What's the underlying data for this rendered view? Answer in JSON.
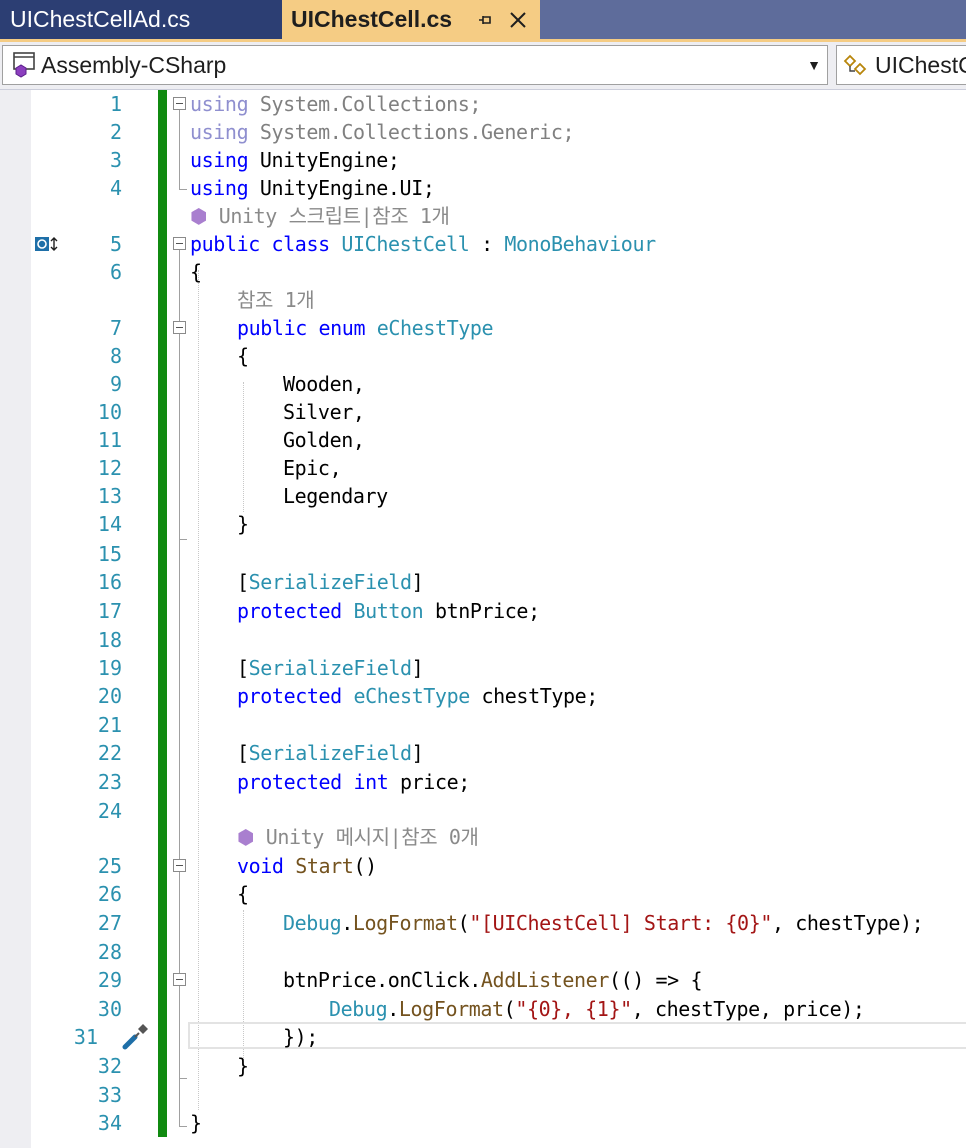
{
  "tabs": [
    {
      "label": "UIChestCellAd.cs",
      "active": false
    },
    {
      "label": "UIChestCell.cs",
      "active": true
    }
  ],
  "tab_icons": {
    "pin": "pin-icon",
    "close": "close-icon"
  },
  "nav": {
    "project": "Assembly-CSharp",
    "class": "UIChestC"
  },
  "lens": {
    "class_refs": "Unity 스크립트|참조 1개",
    "enum_refs": "참조 1개",
    "start_refs": "Unity 메시지|참조 0개"
  },
  "line_numbers": [
    "1",
    "2",
    "3",
    "4",
    "5",
    "6",
    "7",
    "8",
    "9",
    "10",
    "11",
    "12",
    "13",
    "14",
    "15",
    "16",
    "17",
    "18",
    "19",
    "20",
    "21",
    "22",
    "23",
    "24",
    "25",
    "26",
    "27",
    "28",
    "29",
    "30",
    "31",
    "32",
    "33",
    "34"
  ],
  "code": {
    "l1_kw": "using",
    "l1_rest": " System.Collections;",
    "l2_kw": "using",
    "l2_rest": " System.Collections.Generic;",
    "l3_kw": "using",
    "l3_rest": " UnityEngine;",
    "l4_kw": "using",
    "l4_rest": " UnityEngine.UI;",
    "l5_kw1": "public",
    "l5_kw2": "class",
    "l5_name": "UIChestCell",
    "l5_colon": " : ",
    "l5_base": "MonoBehaviour",
    "l6": "{",
    "l7_kw1": "public",
    "l7_kw2": "enum",
    "l7_name": "eChestType",
    "l8": "{",
    "l9": "Wooden,",
    "l10": "Silver,",
    "l11": "Golden,",
    "l12": "Epic,",
    "l13": "Legendary",
    "l14": "}",
    "l16_open": "[",
    "l16_attr": "SerializeField",
    "l16_close": "]",
    "l17_kw": "protected",
    "l17_type": "Button",
    "l17_rest": " btnPrice;",
    "l19_open": "[",
    "l19_attr": "SerializeField",
    "l19_close": "]",
    "l20_kw": "protected",
    "l20_type": "eChestType",
    "l20_rest": " chestType;",
    "l22_open": "[",
    "l22_attr": "SerializeField",
    "l22_close": "]",
    "l23_kw1": "protected",
    "l23_kw2": "int",
    "l23_rest": " price;",
    "l25_kw": "void",
    "l25_name": "Start",
    "l25_rest": "()",
    "l26": "{",
    "l27_type": "Debug",
    "l27_dot": ".",
    "l27_method": "LogFormat",
    "l27_open": "(",
    "l27_str": "\"[UIChestCell] Start: {0}\"",
    "l27_rest": ", chestType);",
    "l29_a": "btnPrice.onClick.",
    "l29_method": "AddListener",
    "l29_rest": "(() => {",
    "l30_type": "Debug",
    "l30_dot": ".",
    "l30_method": "LogFormat",
    "l30_open": "(",
    "l30_str": "\"{0}, {1}\"",
    "l30_rest": ", chestType, price);",
    "l31": "});",
    "l32": "}",
    "l34": "}"
  },
  "margin_icons": {
    "line5": "override-navigation-icon",
    "line31": "quick-action-screwdriver-icon"
  }
}
